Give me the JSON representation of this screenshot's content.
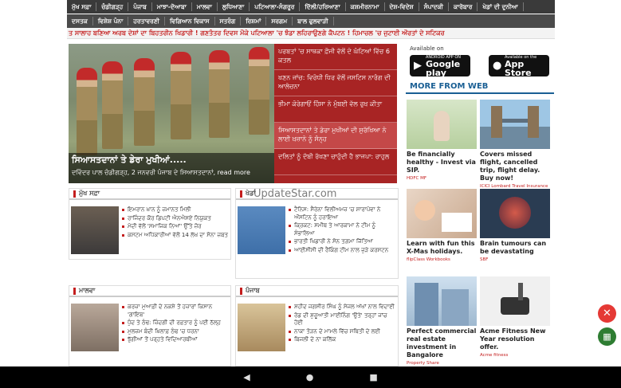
{
  "nav": {
    "row1": [
      "ਮੁੱਖ ਸਫ਼ਾ",
      "ਚੰਡੀਗੜ੍ਹ",
      "ਪੰਜਾਬ",
      "ਮਾਝਾ-ਦੋਆਬਾ",
      "ਮਾਲਵਾ",
      "ਲੁਧਿਆਣਾ",
      "ਪਟਿਆਲਾ-ਸੰਗਰੂਰ",
      "ਦਿੱਲੀ/ਹਰਿਆਣਾ",
      "ਕਸ਼ਮੀਰਨਾਮਾ",
      "ਦੇਸ਼-ਵਿਦੇਸ਼",
      "ਸੰਪਾਦਕੀ",
      "ਕਾਰੋਬਾਰ",
      "ਖੇਡਾਂ ਦੀ ਦੁਨੀਆ"
    ],
    "row2": [
      "ਦਸਤਕ",
      "ਵਿਸ਼ੇਸ਼ ਪੰਨਾ",
      "ਹਰਤਾਵਰਣੀ",
      "ਵਿਗਿਆਨ ਵਿਕਾਸ",
      "ਸਤਰੰਗ",
      "ਰਿਸ਼ਮਾਂ",
      "ਸਰਗਮ",
      "ਬਾਲ ਫੁਲਵਾੜੀ"
    ]
  },
  "ticker": "ਤ ਸਾਲਾਹ ਬਣਿਆ ਅਰਬ ਦੇਸ਼ਾਂ ਦਾ ਬਿਹਤਰੀਨ ਖਿਡਾਰੀ !   ਗਣਤੰਤਰ ਦਿਵਸ ਮੌਕੇ ਪਟਿਆਲਾ 'ਚ ਝੰਡਾ ਲਹਿਰਾਉਣਗੇ ਕੈਪਟਨ !   ਹਿਮਾਚਲ 'ਚ ਜੁਟਾਈ ਔਰਤਾਂ ਦੇ ਸਟਿਕਰ",
  "slider": {
    "title": "ਸਿਆਸਤਦਾਨਾਂ ਤੇ ਡੇਰਾ ਮੁਖੀਆਂ.....",
    "caption": "ਦਵਿੰਦਰ ਪਾਲ ਚੰਡੀਗੜ੍ਹ, 2 ਜਨਵਰੀ ਪੰਜਾਬ ਦੇ ਸਿਆਸਤਦਾਨਾਂ, read more"
  },
  "headlines": [
    "ਪਰਬਤਾਂ 'ਚ ਸਾਥਕਾ ਫ਼ੌਜੀ ਵੱਲੋਂ ਦੋ ਘੰਟਿਆਂ ਵਿੱਚ 6 ਕਤਲ",
    "ਖਣਨ ਜਾਂਚ: ਵਿਰੋਧੀ ਧਿਰ ਵੱਲੋਂ ਜਸਟਿਸ ਨਾਰੰਗ ਦੀ ਆਲੋਚਨਾ",
    "ਭੀਮਾ ਕੋਰੇਗਾਓਂ ਹਿੰਸਾ ਨੇ ਮੁੰਬਈ ਵੱਲ ਰੁਖ਼ ਕੀਤਾ",
    "ਸਿਆਸਤਦਾਨਾਂ ਤੇ ਡੇਰਾ ਮੁਖੀਆਂ ਦੀ ਸੁਰੱਖਿਆ ਨੇ ਲਾਈ ਖ਼ਜ਼ਾਨੇ ਨੂੰ ਸੰਨ੍ਹ",
    "ਦਲਿਤਾਂ ਨੂੰ ਦੱਬੀ ਰੱਖਣਾ ਚਾਹੁੰਦੀ ਹੈ ਭਾਜਪਾ: ਰਾਹੁਲ"
  ],
  "apps": {
    "label": "Available on",
    "android_small": "ANDROID APP ON",
    "android_big": "Google play",
    "ios_small": "Available on the",
    "ios_big": "App Store"
  },
  "more_from_web": "MORE FROM WEB",
  "ads": [
    {
      "title": "Be financially healthy - Invest via SIP.",
      "source": "HDFC MF"
    },
    {
      "title": "Covers missed flight, cancelled trip, flight delay. Buy now!",
      "source": "ICICI Lombard Travel Insurance"
    },
    {
      "title": "Learn with fun this X-Mas holidays.",
      "source": "flipClass Workbooks"
    },
    {
      "title": "Brain tumours can be devastating",
      "source": "SBF"
    },
    {
      "title": "Perfect commercial real estate investment in Bangalore",
      "source": "Property Share"
    },
    {
      "title": "Acme Fitness New Year resolution offer.",
      "source": "Acme fitness"
    }
  ],
  "sections": {
    "main": {
      "title": "ਮੁੱਖ ਸਫ਼ਾ",
      "items": [
        "ਇਮਰਾਨ ਖ਼ਾਨ ਨੂੰ ਜ਼ਮਾਨਤ ਮਿਲੀ",
        "ਰਾਜਿੰਦਰ ਕੌਰ ਡਿਪਟੀ ਐਨਐਸਏ ਨਿਯੁਕਤ",
        "ਮੋਦੀ ਵੱਲੋਂ 'ਸਮਾਜਿਕ ਨਿਆਂ' ਉੱਤੇ ਜ਼ੋਰ",
        "ਕਸਟਮ ਅਧਿਕਾਰੀਆਂ ਵੱਲੋਂ 14 ਲੱਖ ਦਾ ਸੋਨਾ ਜ਼ਬਤ"
      ]
    },
    "sports": {
      "title": "ਖੇਡਾਂ",
      "items": [
        "ਟੈਨਿਸ: ਸੈਰੇਨਾ ਵਿਲੀਅਮਜ਼ 'ਚ ਸ਼ਾਰਾਪੋਵਾ ਨੇ ਔਸਟਿਨ ਨੂੰ ਹਰਾਇਆ",
        "ਕ੍ਰਿਕਟ: ਸਮੀਥ ਤੇ ਆਰਕਾਮਾ ਨੇ ਟੀਮ ਨੂੰ ਸੰਭਾਲਿਆ",
        "ਭਾਰਤੀ ਖਿਡਾਰੀ ਨੇ ਸੋਨ ਤਗ਼ਮਾ ਜਿੱਤਿਆ",
        "ਆਈਸੀਸੀ ਦੀ ਰੈਂਕਿੰਗ ਟੀਮ ਨਾਲ ਜੁੜੇ ਕਰਸਟਨ"
      ]
    },
    "malwa": {
      "title": "ਮਾਲਵਾ",
      "items": [
        "ਕਰਜ਼ਾ ਮੁਆਫ਼ੀ ਦੇ ਨਕਸ਼ੇ ਤੋਂ ਹਜ਼ਾਰਾਂ ਕਿਸਾਨ 'ਗਾਇਬ'",
        "ਧੁੰਦ ਤੇ ਠੰਢ: ਜ਼ਿੰਦਗੀ ਦੀ ਰਫ਼ਤਾਰ ਨੂੰ ਪਈ ਠੱਲ੍ਹ",
        "ਮੁਲਜ਼ਮ ਬੰਦੀ ਖ਼ਿਲਾਫ਼ ਠੰਢ 'ਚ ਧਰਨਾ",
        "ਝੁੱਗੀਆਂ ਤੋਂ ਪਰ੍ਹਤੇ ਵਿਦਿਆਰਥੀਆਂ"
      ]
    },
    "punjab": {
      "title": "ਪੰਜਾਬ",
      "items": [
        "ਸ਼ਹੀਦ ਜਗਸੀਰ ਸਿੰਘ ਨੂੰ ਸੇਜਲ ਅੱਖਾਂ ਨਾਲ ਵਿਦਾਈ",
        "ਰੋਡ ਦੀ ਸ਼ੁਰੂਆਤੀ ਮਾਈਨਿੰਗ 'ਉਤੇ' ਤਰ੍ਹਾਂ ਜਾਂਚ ਹੋਈ",
        "ਨਾਕਾ ਤੋੜਨ ਦੇ ਮਾਮਲੇ ਵਿੱਚ ਸਥਿਤੀ ਦੇ ਲਈ",
        "ਬਿਜਲੀ ਦੇ ਨਾ ਕਲਿੱਕ"
      ]
    }
  },
  "watermark": "UpdateStar.com"
}
